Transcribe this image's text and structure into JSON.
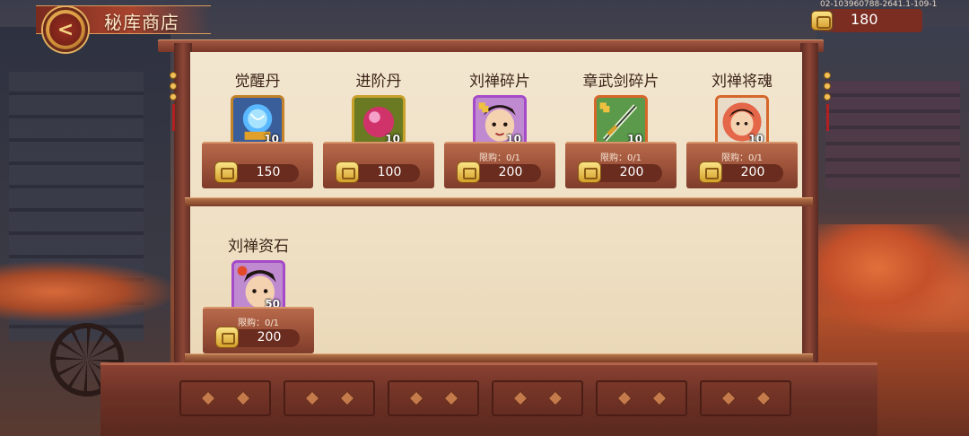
{
  "header": {
    "title": "秘库商店",
    "back_glyph": "<",
    "server_id": "02-103960788-2641.1-109-1",
    "currency_icon": "gold-ingot-icon",
    "currency_value": "180"
  },
  "shop": {
    "items": [
      {
        "name": "觉醒丹",
        "icon": "awakening-pill-icon",
        "quantity": "10",
        "limit": "",
        "price": "150",
        "rarity_color": "#c3822a"
      },
      {
        "name": "进阶丹",
        "icon": "advance-pill-icon",
        "quantity": "10",
        "limit": "",
        "price": "100",
        "rarity_color": "#c8a12a"
      },
      {
        "name": "刘禅碎片",
        "icon": "liu-shan-shard-icon",
        "quantity": "10",
        "limit": "限购：0/1",
        "price": "200",
        "rarity_color": "#a54ac8"
      },
      {
        "name": "章武剑碎片",
        "icon": "zhangwu-sword-shard-icon",
        "quantity": "10",
        "limit": "限购：0/1",
        "price": "200",
        "rarity_color": "#d6662a"
      },
      {
        "name": "刘禅将魂",
        "icon": "liu-shan-soul-icon",
        "quantity": "10",
        "limit": "限购：0/1",
        "price": "200",
        "rarity_color": "#d6662a"
      },
      {
        "name": "刘禅资石",
        "icon": "liu-shan-stone-icon",
        "quantity": "50",
        "limit": "限购：0/1",
        "price": "200",
        "rarity_color": "#a54ac8"
      }
    ]
  },
  "colors": {
    "accent_gold": "#f1c05a",
    "frame_wood": "#8d4636",
    "panel_paper": "#f3e6cf"
  }
}
